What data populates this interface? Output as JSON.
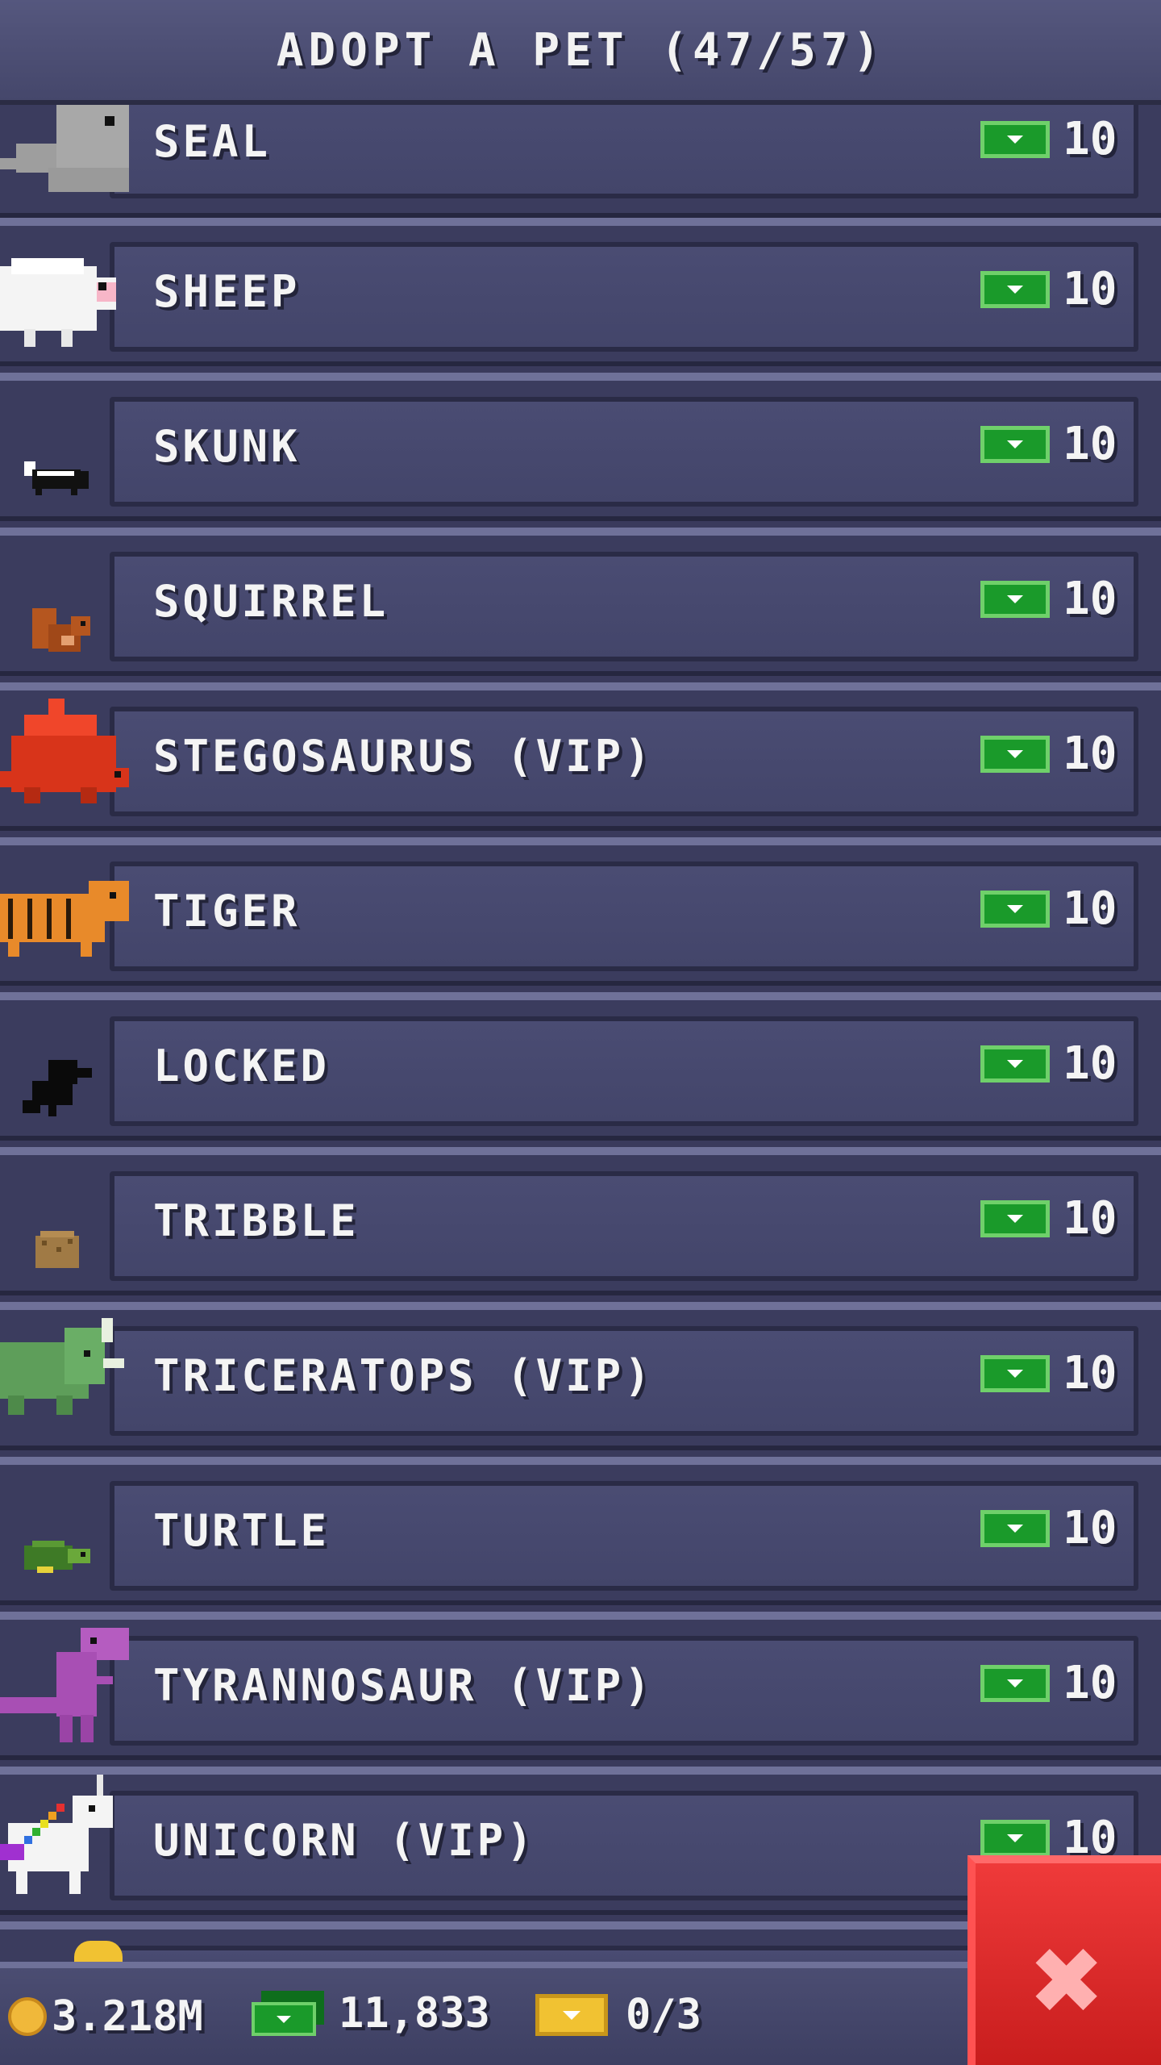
{
  "header": {
    "title": "ADOPT A PET (47/57)"
  },
  "pets": [
    {
      "name": "SEAL",
      "price": "10",
      "icon": "seal-icon"
    },
    {
      "name": "SHEEP",
      "price": "10",
      "icon": "sheep-icon"
    },
    {
      "name": "SKUNK",
      "price": "10",
      "icon": "skunk-icon"
    },
    {
      "name": "SQUIRREL",
      "price": "10",
      "icon": "squirrel-icon"
    },
    {
      "name": "STEGOSAURUS (VIP)",
      "price": "10",
      "icon": "stegosaurus-icon"
    },
    {
      "name": "TIGER",
      "price": "10",
      "icon": "tiger-icon"
    },
    {
      "name": "LOCKED",
      "price": "10",
      "icon": "locked-silhouette-icon"
    },
    {
      "name": "TRIBBLE",
      "price": "10",
      "icon": "tribble-icon"
    },
    {
      "name": "TRICERATOPS (VIP)",
      "price": "10",
      "icon": "triceratops-icon"
    },
    {
      "name": "TURTLE",
      "price": "10",
      "icon": "turtle-icon"
    },
    {
      "name": "TYRANNOSAUR (VIP)",
      "price": "10",
      "icon": "tyrannosaur-icon"
    },
    {
      "name": "UNICORN (VIP)",
      "price": "10",
      "icon": "unicorn-icon"
    }
  ],
  "footer": {
    "coins": "3.218M",
    "cash": "11,833",
    "tickets": "0/3"
  },
  "colors": {
    "background": "#3a3a5c",
    "cash_green": "#1a9a2a",
    "close_red": "#e02a2a",
    "coin_gold": "#f0b83a"
  }
}
